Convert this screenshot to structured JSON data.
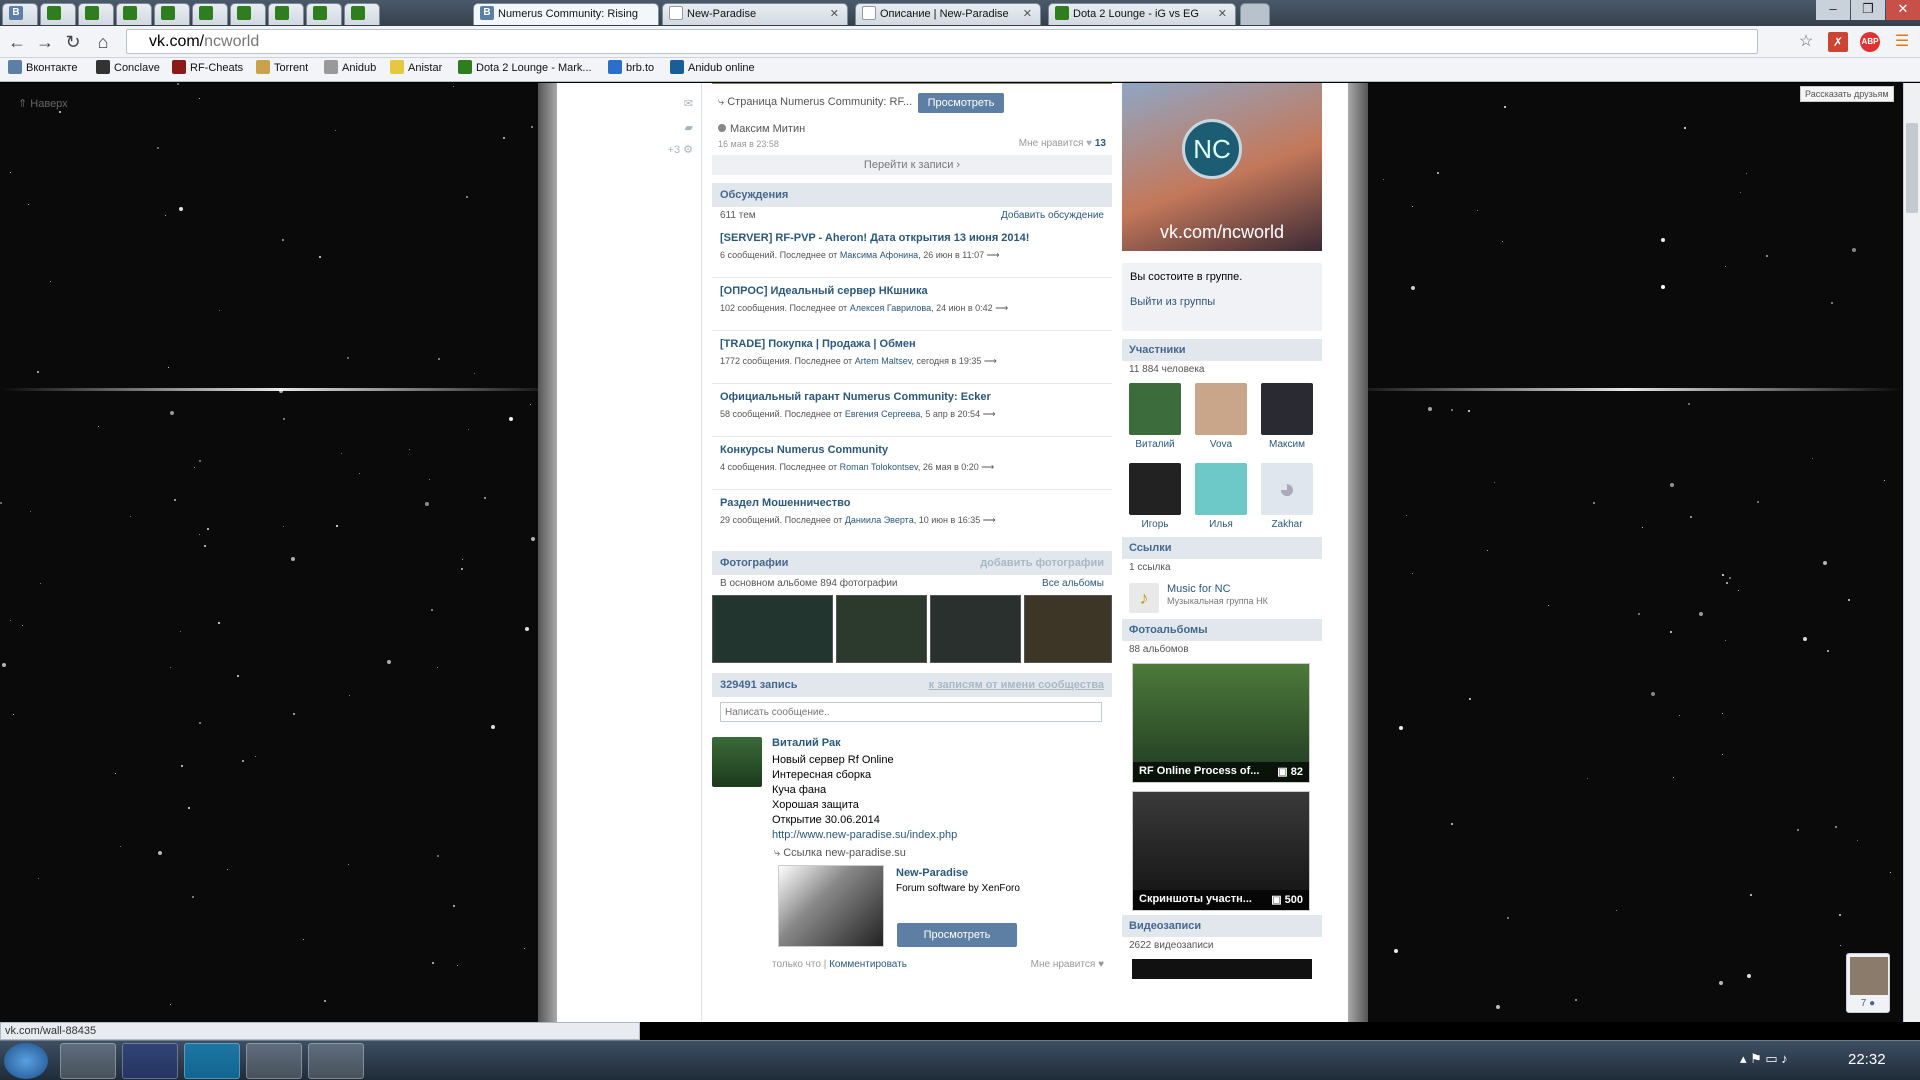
{
  "tabs": [
    {
      "label": "Numerus Community: Rising",
      "active": true
    },
    {
      "label": "New-Paradise"
    },
    {
      "label": "Описание | New-Paradise"
    },
    {
      "label": "Dota 2 Lounge - iG vs EG"
    }
  ],
  "url": {
    "host": "vk.com/",
    "path": "ncworld"
  },
  "bookmarks": [
    "Вконтакте",
    "Conclave",
    "RF-Cheats",
    "Torrent",
    "Anidub",
    "Anistar",
    "Dota 2 Lounge - Mark...",
    "brb.to",
    "Anidub online"
  ],
  "share_tooltip": "Рассказать друзьям",
  "left_nav": {
    "up": "Наверх",
    "plus_count": "+3"
  },
  "post_top": {
    "link_text": "Страница Numerus Community: RF...",
    "view_btn": "Просмотреть",
    "author": "Максим Митин",
    "date": "16 мая в 23:58",
    "likes_label": "Мне нравится",
    "likes": "13",
    "goto": "Перейти к записи"
  },
  "discussions": {
    "title": "Обсуждения",
    "count": "611 тем",
    "add": "Добавить обсуждение",
    "topics": [
      {
        "title": "[SERVER] RF-PVP - Aheron! Дата открытия 13 июня 2014!",
        "count": "6 сообщений. Последнее от",
        "by": "Максима Афонина",
        "when": ", 26 июн в 11:07"
      },
      {
        "title": "[ОПРОС] Идеальный сервер НКшника",
        "count": "102 сообщения. Последнее от",
        "by": "Алексея Гаврилова",
        "when": ", 24 июн в 0:42"
      },
      {
        "title": "[TRADE] Покупка | Продажа | Обмен",
        "count": "1772 сообщения. Последнее от",
        "by": "Artem Maltsev",
        "when": ", сегодня в 19:35"
      },
      {
        "title": "Официальный гарант Numerus Community: Ecker",
        "count": "58 сообщений. Последнее от",
        "by": "Евгения Сергеева",
        "when": ", 5 апр в 20:54"
      },
      {
        "title": "Конкурсы Numerus Community",
        "count": "4 сообщения. Последнее от",
        "by": "Roman Tolokontsev",
        "when": ", 26 мая в 0:20"
      },
      {
        "title": "Раздел Мошенничество",
        "count": "29 сообщений. Последнее от",
        "by": "Даниила Эверта",
        "when": ", 10 июн в 16:35"
      }
    ]
  },
  "photos": {
    "title": "Фотографии",
    "add": "добавить фотографии",
    "info": "В основном альбоме 894 фотографии",
    "all": "Все альбомы"
  },
  "wall": {
    "count": "329491 запись",
    "community_link": "к записям от имени сообщества",
    "placeholder": "Написать сообщение..",
    "post": {
      "author": "Виталий Рак",
      "lines": [
        "Новый сервер Rf Online",
        "Интересная сборка",
        "Куча фана",
        "Хорошая защита",
        "Открытие 30.06.2014"
      ],
      "url": "http://www.new-paradise.su/index.php",
      "link_label": "Ссылка new-paradise.su",
      "card_title": "New-Paradise",
      "card_desc": "Forum software by XenForo",
      "card_btn": "Просмотреть",
      "just_now": "только что",
      "comment": "Комментировать",
      "like": "Мне нравится"
    }
  },
  "group": {
    "banner_text": "vk.com/ncworld",
    "logo": "NC",
    "member_note": "Вы состоите в группе.",
    "leave": "Выйти из группы"
  },
  "members": {
    "title": "Участники",
    "count": "11 884 человека",
    "list": [
      "Виталий",
      "Vova",
      "Максим",
      "Игорь",
      "Илья",
      "Zakhar"
    ]
  },
  "links": {
    "title": "Ссылки",
    "count": "1 ссылка",
    "name": "Music for NC",
    "desc": "Музыкальная группа НК"
  },
  "albums": {
    "title": "Фотоальбомы",
    "count": "88 альбомов",
    "items": [
      {
        "name": "RF Online Process of...",
        "count": "82"
      },
      {
        "name": "Скриншоты участн...",
        "count": "500"
      }
    ]
  },
  "videos": {
    "title": "Видеозаписи",
    "count": "2622 видеозаписи"
  },
  "chat_count": "7",
  "status_url": "vk.com/wall-88435",
  "clock": "22:32",
  "colors": {
    "vk_blue": "#45688e",
    "link": "#2b587a",
    "header_bg": "#e1e7ed"
  }
}
